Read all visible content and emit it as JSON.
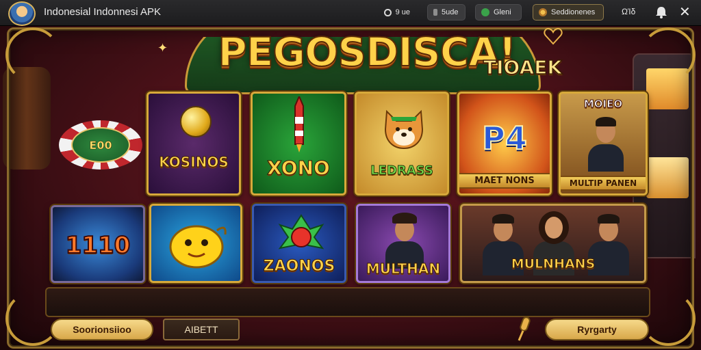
{
  "window": {
    "title": "Indonesial Indonnesi APK",
    "pills": [
      "9 ue",
      "5ude",
      "Gleni",
      "Seddionenes"
    ],
    "count": "ΩΊδ"
  },
  "logo": {
    "main": "PEGOSDISCA!",
    "sub": "TIOAEK"
  },
  "chip": {
    "label": "E00"
  },
  "tiles": [
    {
      "label": "KOSINOS"
    },
    {
      "label": "XONO"
    },
    {
      "label": "LEDRASS"
    },
    {
      "label": "P4",
      "sub": "MAET NONS"
    },
    {
      "label": "MOIEO",
      "sub": "MULTIP PANEN"
    },
    {
      "label": "1110"
    },
    {
      "label": ""
    },
    {
      "label": "ZAONOS"
    },
    {
      "label": "MULTHAN"
    },
    {
      "label": "MULNHANS"
    }
  ],
  "bottom": {
    "left_button": "Soorionsiioo",
    "mid_button": "AIBETT",
    "right_button": "Ryrgarty"
  },
  "colors": {
    "accent_gold": "#d7a93a",
    "background_red": "#4a1118",
    "topbar": "#1c1c1e"
  },
  "icons": [
    "app-avatar-icon",
    "circle-icon",
    "bar-icon",
    "green-dot-icon",
    "coin-icon",
    "bell-icon",
    "close-icon",
    "heart-icon",
    "sparkle-icon",
    "microphone-icon"
  ]
}
